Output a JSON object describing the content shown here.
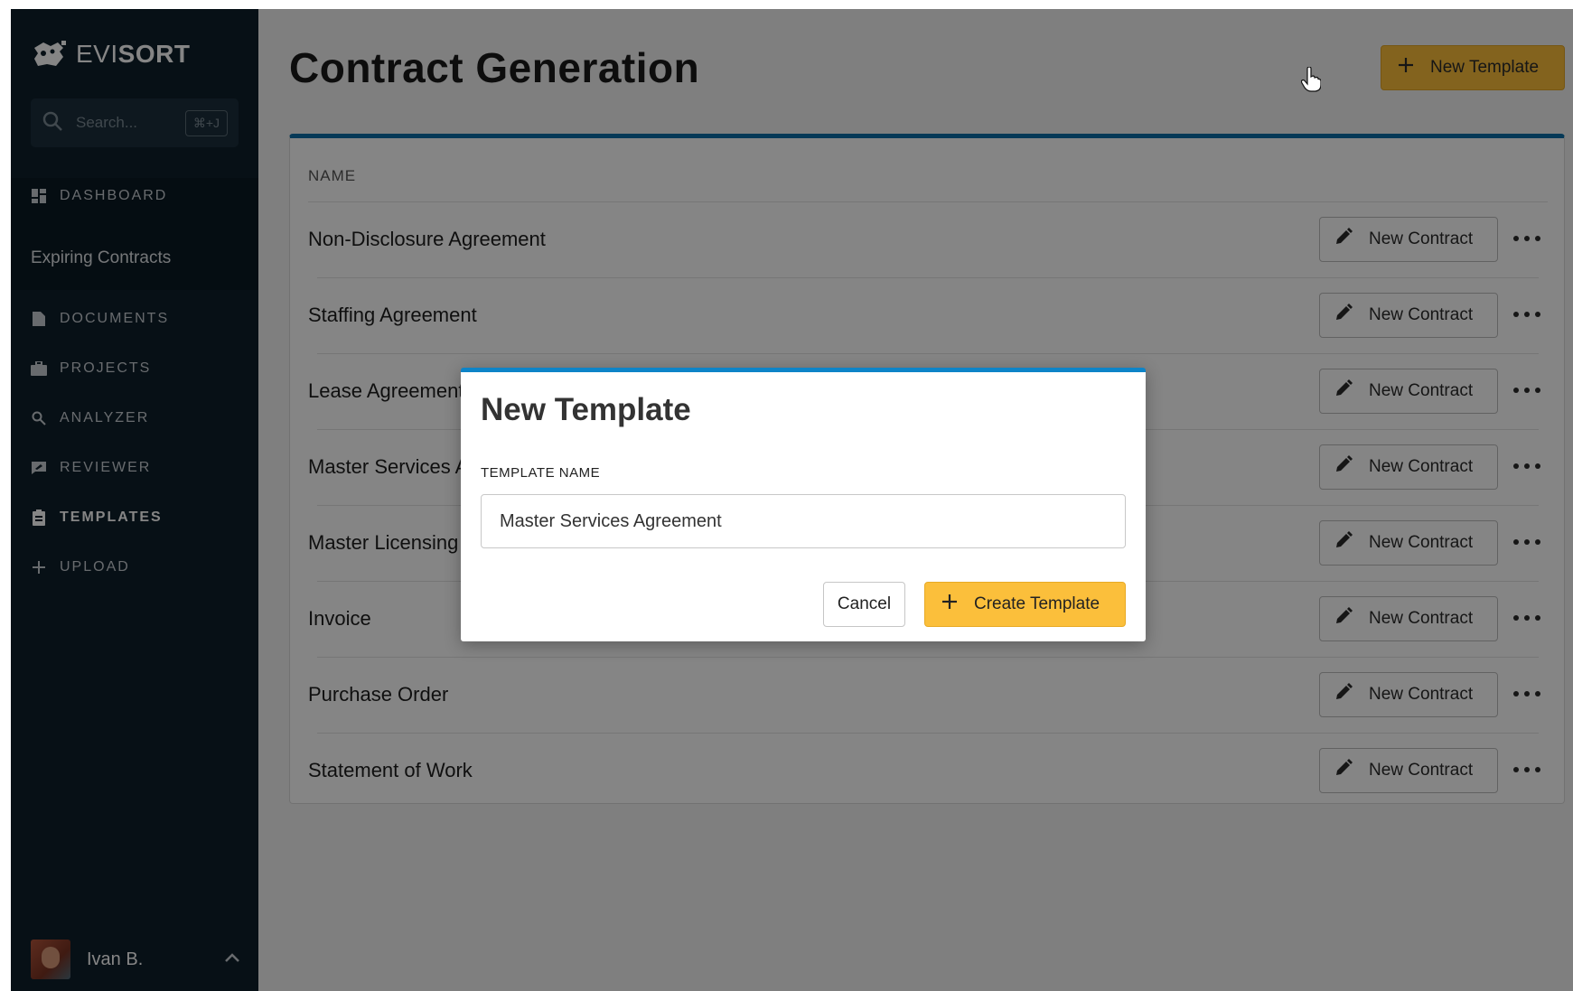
{
  "sidebar": {
    "brand_light": "EVI",
    "brand_bold": "SORT",
    "search_placeholder": "Search...",
    "search_shortcut": "⌘+J",
    "nav": [
      {
        "label": "DASHBOARD",
        "icon": "dashboard-icon"
      },
      {
        "label": "DOCUMENTS",
        "icon": "document-icon"
      },
      {
        "label": "PROJECTS",
        "icon": "briefcase-icon"
      },
      {
        "label": "ANALYZER",
        "icon": "search-icon"
      },
      {
        "label": "REVIEWER",
        "icon": "review-icon"
      },
      {
        "label": "TEMPLATES",
        "icon": "clipboard-icon",
        "active": true
      },
      {
        "label": "UPLOAD",
        "icon": "plus-icon"
      }
    ],
    "sub_item": "Expiring Contracts",
    "user_name": "Ivan B."
  },
  "main": {
    "title": "Contract Generation",
    "new_template_label": "New Template",
    "column_header": "NAME",
    "row_button_label": "New Contract",
    "templates": [
      "Non-Disclosure Agreement",
      "Staffing Agreement",
      "Lease Agreement",
      "Master Services Agreement",
      "Master Licensing Agreement",
      "Invoice",
      "Purchase Order",
      "Statement of Work"
    ]
  },
  "modal": {
    "title": "New Template",
    "field_label": "TEMPLATE NAME",
    "field_value": "Master Services Agreement",
    "cancel_label": "Cancel",
    "create_label": "Create Template"
  },
  "colors": {
    "sidebar_bg": "#0e1f2b",
    "accent_yellow": "#fbbf3b",
    "accent_blue": "#0d84c8"
  }
}
